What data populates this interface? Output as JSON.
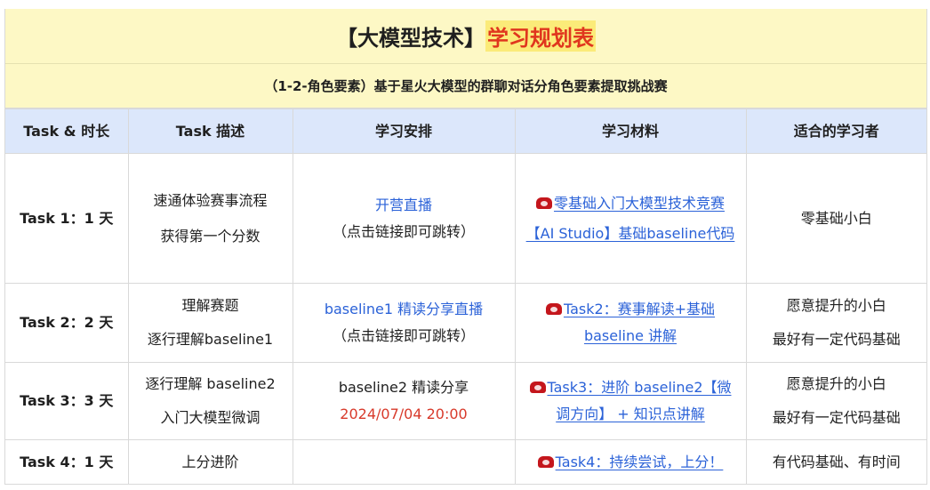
{
  "header": {
    "title_prefix": "【大模型技术】",
    "title_highlight": "学习规划表",
    "subtitle": "（1-2-角色要素）基于星火大模型的群聊对话分角色要素提取挑战赛"
  },
  "columns": [
    "Task & 时长",
    "Task 描述",
    "学习安排",
    "学习材料",
    "适合的学习者"
  ],
  "rows": [
    {
      "task": "Task 1：1 天",
      "desc": [
        "速通体验赛事流程",
        "获得第一个分数"
      ],
      "plan_link": "开营直播",
      "plan_note": "（点击链接即可跳转）",
      "materials": [
        {
          "text": "零基础入门大模型技术竞赛",
          "icon": "phone-icon"
        },
        {
          "text": "【AI Studio】基础baseline代码",
          "icon": ""
        }
      ],
      "audience": [
        "零基础小白"
      ]
    },
    {
      "task": "Task 2：2 天",
      "desc": [
        "理解赛题",
        "逐行理解baseline1"
      ],
      "plan_link": "baseline1 精读分享直播",
      "plan_note": "（点击链接即可跳转）",
      "materials": [
        {
          "text": "Task2：赛事解读+基础baseline 讲解",
          "icon": "phone-icon"
        }
      ],
      "audience": [
        "愿意提升的小白",
        "最好有一定代码基础"
      ]
    },
    {
      "task": "Task 3：3 天",
      "desc": [
        "逐行理解 baseline2",
        "入门大模型微调"
      ],
      "plan_text": "baseline2 精读分享",
      "plan_date": "2024/07/04 20:00",
      "materials": [
        {
          "text": "Task3：进阶 baseline2【微调方向】 + 知识点讲解",
          "icon": "phone-icon"
        }
      ],
      "audience": [
        "愿意提升的小白",
        "最好有一定代码基础"
      ]
    },
    {
      "task": "Task 4：1 天",
      "desc": [
        "上分进阶"
      ],
      "plan_text": "",
      "materials": [
        {
          "text": "Task4：持续尝试，上分！",
          "icon": "phone-icon"
        }
      ],
      "audience": [
        "有代码基础、有时间"
      ]
    }
  ],
  "colors": {
    "title_bg": "#fdf8c5",
    "header_bg": "#dce7fb",
    "link": "#2b62d8",
    "accent_red": "#e0361e",
    "highlight": "#fbeb79"
  }
}
